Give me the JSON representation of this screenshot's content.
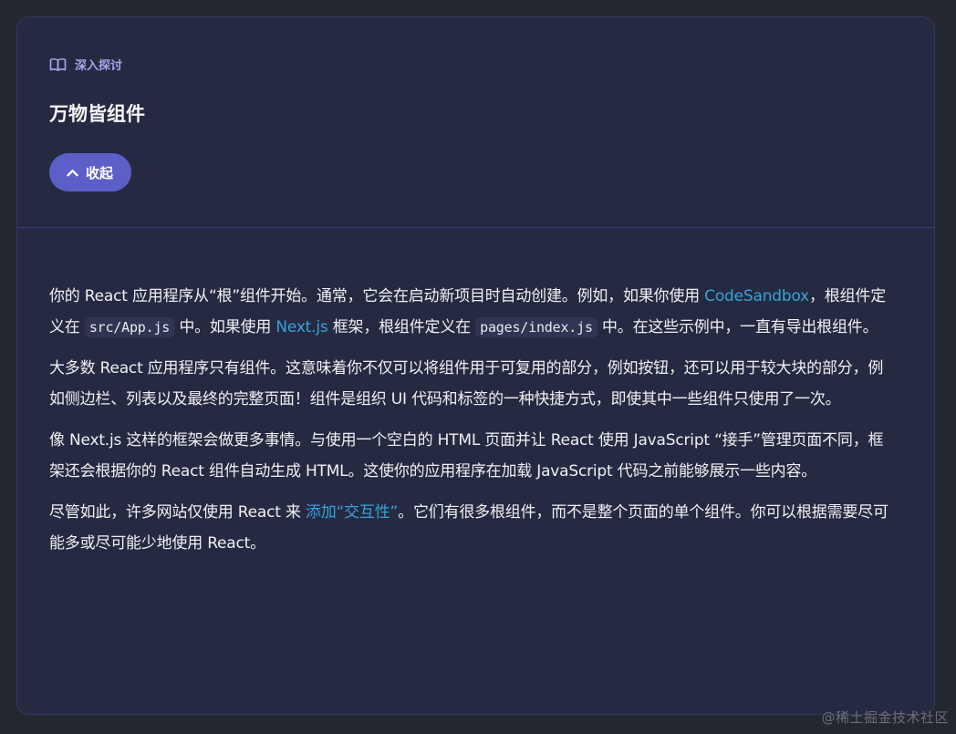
{
  "header": {
    "eyebrow_label": "深入探讨",
    "title": "万物皆组件",
    "toggle_label": "收起"
  },
  "paragraphs": [
    {
      "p1_a": "你的 React 应用程序从“根”组件开始。通常，它会在启动新项目时自动创建。例如，如果你使用 ",
      "p1_link1": "CodeSandbox",
      "p1_b": "，根组件定义在 ",
      "p1_code1": "src/App.js",
      "p1_c": " 中。如果使用 ",
      "p1_link2": "Next.js",
      "p1_d": " 框架，根组件定义在 ",
      "p1_code2": "pages/index.js",
      "p1_e": " 中。在这些示例中，一直有导出根组件。"
    },
    {
      "text": "大多数 React 应用程序只有组件。这意味着你不仅可以将组件用于可复用的部分，例如按钮，还可以用于较大块的部分，例如侧边栏、列表以及最终的完整页面！组件是组织 UI 代码和标签的一种快捷方式，即使其中一些组件只使用了一次。"
    },
    {
      "text": "像 Next.js 这样的框架会做更多事情。与使用一个空白的 HTML 页面并让 React 使用 JavaScript “接手”管理页面不同，框架还会根据你的 React 组件自动生成 HTML。这使你的应用程序在加载 JavaScript 代码之前能够展示一些内容。"
    },
    {
      "p4_a": "尽管如此，许多网站仅使用 React 来 ",
      "p4_link": "添加“交互性”",
      "p4_b": "。它们有很多根组件，而不是整个页面的单个组件。你可以根据需要尽可能多或尽可能少地使用 React。"
    }
  ],
  "watermark": "@稀土掘金技术社区",
  "icons": {
    "eyebrow_icon": "book-open-icon",
    "toggle_icon": "chevron-up-icon"
  },
  "colors": {
    "page_bg": "#23272f",
    "card_bg": "#252a42",
    "accent_button": "#5b5fc7",
    "eyebrow": "#a7a9ee",
    "link": "#36a3d9"
  }
}
